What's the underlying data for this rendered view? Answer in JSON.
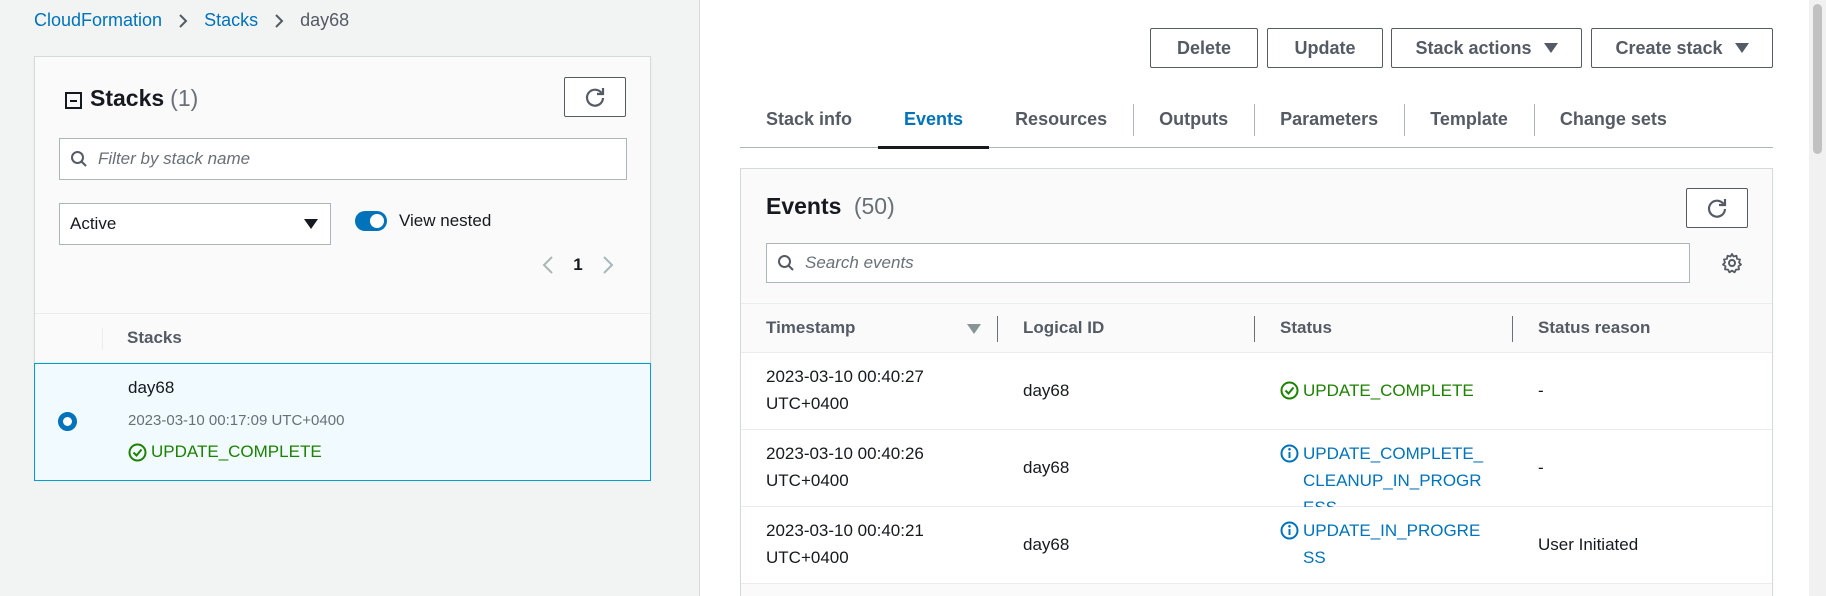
{
  "breadcrumb": {
    "items": [
      "CloudFormation",
      "Stacks"
    ],
    "current": "day68"
  },
  "stacks_panel": {
    "title": "Stacks",
    "count": "(1)",
    "filter_placeholder": "Filter by stack name",
    "status_filter": "Active",
    "view_nested_label": "View nested",
    "view_nested_on": true,
    "page": "1",
    "column_header": "Stacks",
    "stacks": [
      {
        "name": "day68",
        "created": "2023-03-10 00:17:09 UTC+0400",
        "status": "UPDATE_COMPLETE",
        "selected": true
      }
    ]
  },
  "actions": {
    "delete": "Delete",
    "update": "Update",
    "stack_actions": "Stack actions",
    "create_stack": "Create stack"
  },
  "tabs": [
    "Stack info",
    "Events",
    "Resources",
    "Outputs",
    "Parameters",
    "Template",
    "Change sets"
  ],
  "active_tab": "Events",
  "events_panel": {
    "title": "Events",
    "count": "(50)",
    "search_placeholder": "Search events",
    "columns": [
      "Timestamp",
      "Logical ID",
      "Status",
      "Status reason"
    ],
    "rows": [
      {
        "time_line1": "2023-03-10 00:40:27",
        "time_line2": "UTC+0400",
        "logical_id": "day68",
        "status": "UPDATE_COMPLETE",
        "status_kind": "success",
        "reason": "-"
      },
      {
        "time_line1": "2023-03-10 00:40:26",
        "time_line2": "UTC+0400",
        "logical_id": "day68",
        "status": "UPDATE_COMPLETE_CLEANUP_IN_PROGRESS",
        "status_kind": "info",
        "reason": "-"
      },
      {
        "time_line1": "2023-03-10 00:40:21",
        "time_line2": "UTC+0400",
        "logical_id": "day68",
        "status": "UPDATE_IN_PROGRESS",
        "status_kind": "info",
        "reason": "User Initiated"
      }
    ]
  },
  "colors": {
    "link": "#0073bb",
    "success": "#1d8102",
    "text": "#16191f",
    "muted": "#687078"
  }
}
